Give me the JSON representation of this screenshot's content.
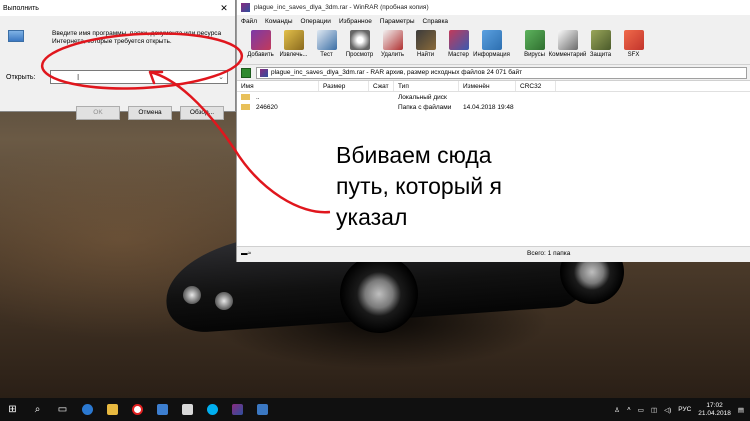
{
  "run_dialog": {
    "title": "Выполнить",
    "close": "✕",
    "description": "Введите имя программы, папки, документа или ресурса Интернета, которые требуется открыть.",
    "open_label": "Открыть:",
    "input_value": "",
    "buttons": {
      "ok": "OK",
      "cancel": "Отмена",
      "browse": "Обзор..."
    }
  },
  "winrar": {
    "title": "plague_inc_saves_dlya_3dm.rar - WinRAR (пробная копия)",
    "menu": [
      "Файл",
      "Команды",
      "Операции",
      "Избранное",
      "Параметры",
      "Справка"
    ],
    "toolbar": [
      {
        "label": "Добавить",
        "color": "#7b3aa8"
      },
      {
        "label": "Извлечь...",
        "color": "#c79a2d"
      },
      {
        "label": "Тест",
        "color": "#3b6ea5"
      },
      {
        "label": "Просмотр",
        "color": "#6b6b6b"
      },
      {
        "label": "Удалить",
        "color": "#b03030"
      },
      {
        "label": "Найти",
        "color": "#8a6a3a"
      },
      {
        "label": "Мастер",
        "color": "#a83a6a"
      },
      {
        "label": "Информация",
        "color": "#2d6fb0"
      },
      {
        "label": "Вирусы",
        "color": "#3f8f3f"
      },
      {
        "label": "Комментарий",
        "color": "#5a5a5a"
      },
      {
        "label": "Защита",
        "color": "#6a7a3a"
      },
      {
        "label": "SFX",
        "color": "#c2342c"
      }
    ],
    "path": "plague_inc_saves_dlya_3dm.rar - RAR архив, размер исходных файлов 24 071 байт",
    "columns": [
      "Имя",
      "Размер",
      "Сжат",
      "Тип",
      "Изменён",
      "CRC32"
    ],
    "rows": [
      {
        "name": "..",
        "size": "",
        "packed": "",
        "type": "Локальный диск",
        "modified": "",
        "crc": ""
      },
      {
        "name": "246620",
        "size": "",
        "packed": "",
        "type": "Папка с файлами",
        "modified": "14.04.2018 19:48",
        "crc": ""
      }
    ],
    "status_total": "Всего: 1 папка"
  },
  "annotation": {
    "text_line1": "Вбиваем сюда",
    "text_line2": "путь, который я",
    "text_line3": "указал",
    "color": "#e0161d"
  },
  "taskbar": {
    "lang": "РУС",
    "time": "17:02",
    "date": "21.04.2018"
  }
}
